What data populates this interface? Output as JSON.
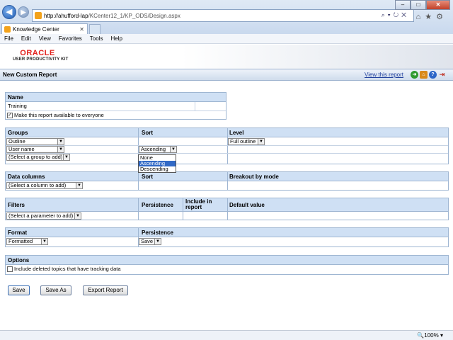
{
  "browser": {
    "url_host": "http://ahufford-lap",
    "url_path": "/KCenter12_1/KP_ODS/Design.aspx",
    "tab_title": "Knowledge Center",
    "menu": [
      "File",
      "Edit",
      "View",
      "Favorites",
      "Tools",
      "Help"
    ],
    "zoom": "100%"
  },
  "brand": {
    "oracle": "ORACLE",
    "product": "USER PRODUCTIVITY KIT",
    "color": "#e2211c"
  },
  "page": {
    "title": "New Custom Report",
    "view_link": "View this report"
  },
  "name_section": {
    "header": "Name",
    "value": "Training",
    "checkbox_label": "Make this report available to everyone",
    "checked": true
  },
  "groups_section": {
    "headers": {
      "groups": "Groups",
      "sort": "Sort",
      "level": "Level"
    },
    "rows": [
      {
        "group": "Outline",
        "sort": "",
        "level": "Full outline"
      },
      {
        "group": "User name",
        "sort": "Ascending",
        "level": ""
      },
      {
        "group": "(Select a group to add)",
        "sort": "",
        "level": ""
      }
    ],
    "sort_options": [
      "None",
      "Ascending",
      "Descending"
    ],
    "sort_highlighted": "Ascending"
  },
  "data_section": {
    "headers": {
      "columns": "Data columns",
      "sort": "Sort",
      "breakout": "Breakout by mode"
    },
    "select": "(Select a column to add)"
  },
  "filters_section": {
    "headers": {
      "filters": "Filters",
      "persistence": "Persistence",
      "include": "Include in report",
      "default": "Default value"
    },
    "select": "(Select a parameter to add)"
  },
  "format_section": {
    "headers": {
      "format": "Format",
      "persistence": "Persistence"
    },
    "format_value": "Formatted",
    "persistence_value": "Save"
  },
  "options_section": {
    "header": "Options",
    "checkbox_label": "Include deleted topics that have tracking data",
    "checked": false
  },
  "buttons": {
    "save": "Save",
    "save_as": "Save As",
    "export": "Export Report"
  }
}
